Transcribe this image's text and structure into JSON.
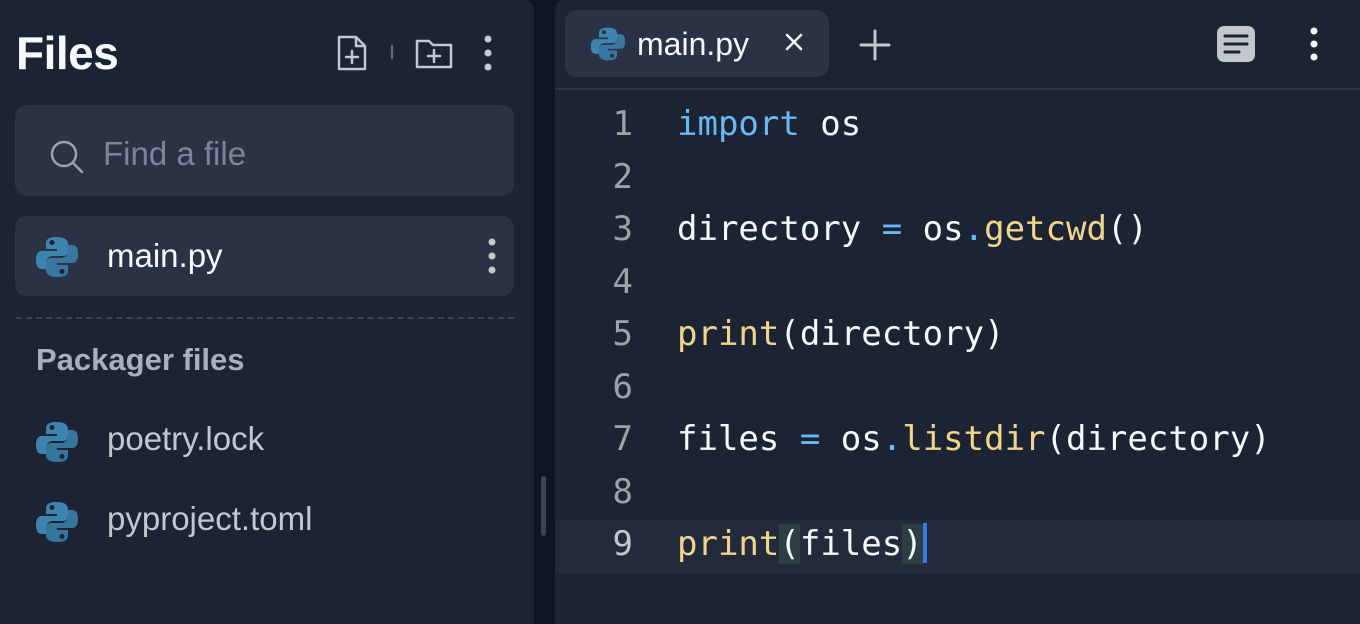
{
  "sidebar": {
    "title": "Files",
    "search_placeholder": "Find a file",
    "files": [
      {
        "name": "main.py",
        "active": true
      }
    ],
    "packager_section_title": "Packager files",
    "packager_files": [
      {
        "name": "poetry.lock"
      },
      {
        "name": "pyproject.toml"
      }
    ]
  },
  "editor": {
    "tab": {
      "label": "main.py"
    },
    "lines": [
      {
        "num": "1"
      },
      {
        "num": "2"
      },
      {
        "num": "3"
      },
      {
        "num": "4"
      },
      {
        "num": "5"
      },
      {
        "num": "6"
      },
      {
        "num": "7"
      },
      {
        "num": "8"
      },
      {
        "num": "9"
      }
    ],
    "tokens": {
      "l1_kw": "import",
      "l1_rest": " os",
      "l3_a": "directory ",
      "l3_op": "=",
      "l3_b": " os",
      "l3_dot": ".",
      "l3_fn": "getcwd",
      "l3_c": "()",
      "l5_fn": "print",
      "l5_rest": "(directory)",
      "l7_a": "files ",
      "l7_op": "=",
      "l7_b": " os",
      "l7_dot": ".",
      "l7_fn": "listdir",
      "l7_c": "(directory)",
      "l9_fn": "print",
      "l9_open": "(",
      "l9_mid": "files",
      "l9_close": ")"
    }
  },
  "colors": {
    "background": "#1c2333",
    "accent": "#2f7de1",
    "keyword": "#69b7f3",
    "function": "#f0d58c",
    "python_blue": "#3d84b0"
  },
  "icons": [
    "new-file-icon",
    "new-folder-icon",
    "kebab-menu-icon",
    "search-icon",
    "python-icon",
    "close-icon",
    "plus-icon",
    "document-outline-icon"
  ]
}
